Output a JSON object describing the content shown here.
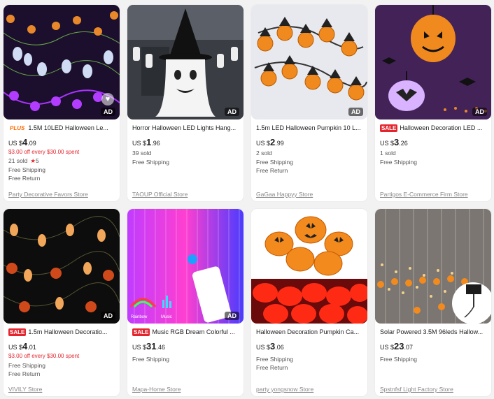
{
  "products": [
    {
      "title": "1.5M 10LED Halloween Le...",
      "tag": "PLUS",
      "price_cur": "US $",
      "price_int": "4",
      "price_dec": ".09",
      "promo": "$3.00 off every $30.00 spent",
      "sold": "21 sold",
      "rating": "5",
      "shipping": "Free Shipping",
      "returns": "Free Return",
      "store": "Party Decorative Favors Store",
      "ad": "AD"
    },
    {
      "title": "Horror Halloween LED Lights Hang...",
      "price_cur": "US $",
      "price_int": "1",
      "price_dec": ".96",
      "sold": "39 sold",
      "shipping": "Free Shipping",
      "store": "TAOUP Official Store",
      "ad": "AD"
    },
    {
      "title": "1.5m LED Halloween Pumpkin 10 L...",
      "price_cur": "US $",
      "price_int": "2",
      "price_dec": ".99",
      "sold": "2 sold",
      "shipping": "Free Shipping",
      "returns": "Free Return",
      "store": "GaGaa Happyy Store",
      "ad": "AD"
    },
    {
      "title": "Halloween Decoration LED ...",
      "tag": "SALE",
      "price_cur": "US $",
      "price_int": "3",
      "price_dec": ".26",
      "sold": "1 sold",
      "shipping": "Free Shipping",
      "store": "Partigos E-Commerce Firm Store",
      "ad": "AD"
    },
    {
      "title": "1.5m Halloween Decoratio...",
      "tag": "SALE",
      "price_cur": "US $",
      "price_int": "4",
      "price_dec": ".01",
      "promo": "$3.00 off every $30.00 spent",
      "shipping": "Free Shipping",
      "returns": "Free Return",
      "store": "VIVILY Store",
      "ad": "AD"
    },
    {
      "title": "Music RGB Dream Colorful ...",
      "tag": "SALE",
      "price_cur": "US $",
      "price_int": "31",
      "price_dec": ".46",
      "shipping": "Free Shipping",
      "store": "Mapa-Home Store",
      "ad": "AD",
      "image_text_1": "Rainbow",
      "image_text_2": "Music"
    },
    {
      "title": "Halloween Decoration Pumpkin Ca...",
      "price_cur": "US $",
      "price_int": "3",
      "price_dec": ".06",
      "shipping": "Free Shipping",
      "returns": "Free Return",
      "store": "party yongsnow Store"
    },
    {
      "title": "Solar Powered 3.5M 96leds Hallow...",
      "price_cur": "US $",
      "price_int": "23",
      "price_dec": ".07",
      "shipping": "Free Shipping",
      "store": "Spstnfsf Light Factory Store"
    }
  ],
  "colors": {
    "sale": "#e4252e",
    "plus": "#ff6a00",
    "promo": "#e4252e"
  }
}
